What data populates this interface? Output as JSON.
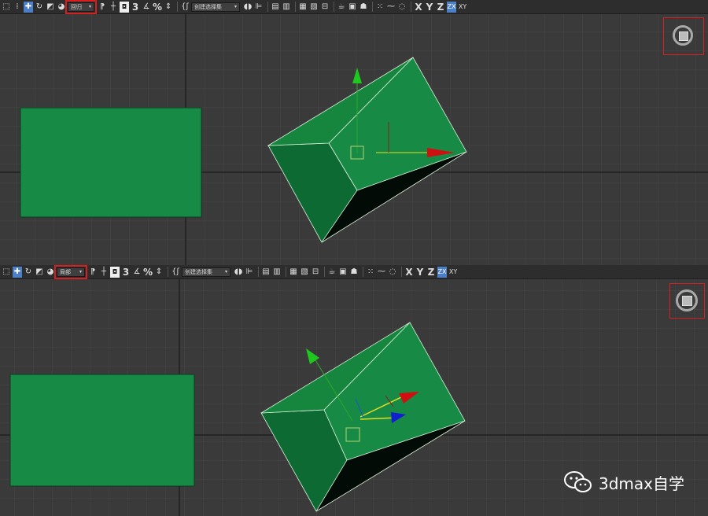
{
  "toolbar_top": {
    "selection_filter": "回归",
    "named_selection": "创建选择集",
    "snap_label": "3",
    "angle_snap": "%",
    "axes": [
      "X",
      "Y",
      "Z",
      "ZX"
    ],
    "xy_label": "XY"
  },
  "toolbar_bottom": {
    "selection_filter": "局部",
    "named_selection": "创建选择集",
    "snap_label": "3",
    "angle_snap": "%",
    "axes": [
      "X",
      "Y",
      "Z",
      "ZX"
    ],
    "xy_label": "XY"
  },
  "colors": {
    "viewport_bg": "#3a3a3a",
    "grid": "#4a4a4a",
    "object_green": "#1a8a45",
    "highlight_red": "#d42020",
    "axis_active": "#4b7fc7"
  },
  "watermark": {
    "text": "3dmax自学"
  }
}
